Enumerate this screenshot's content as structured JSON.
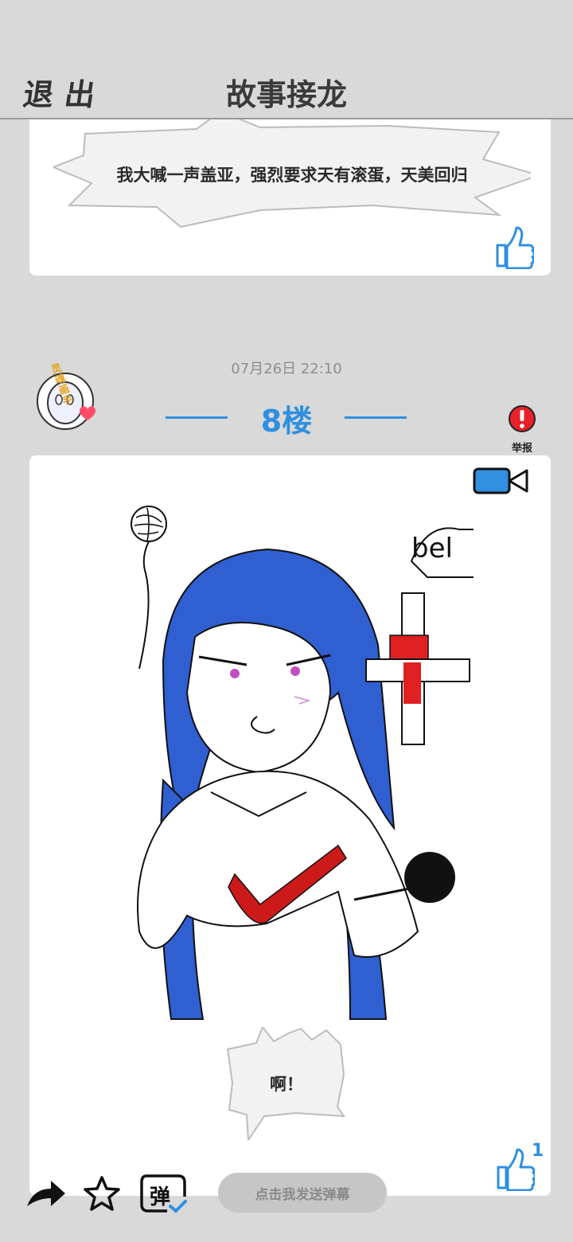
{
  "header": {
    "exit_label": "退出",
    "title": "故事接龙"
  },
  "previous_post": {
    "text": "我大喊一声盖亚，强烈要求天有滚蛋，天美回归"
  },
  "post": {
    "timestamp": "07月26日  22:10",
    "floor": "8楼",
    "report_label": "举报",
    "avatar_badge": "灵魂画手",
    "drawing_text": "bel",
    "reply_text": "啊！",
    "like_count": "1"
  },
  "bottom_bar": {
    "danmaku_toggle_label": "弹",
    "danmaku_placeholder": "点击我发送弹幕"
  },
  "colors": {
    "accent": "#2f8fe0",
    "background": "#d9d9d9",
    "report_red": "#e8202a"
  }
}
